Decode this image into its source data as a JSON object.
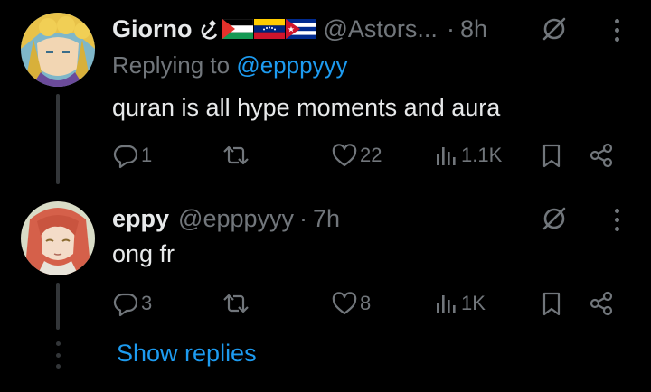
{
  "posts": [
    {
      "name": "Giorno",
      "flags": [
        "hammer-sickle",
        "palestine",
        "venezuela",
        "cuba"
      ],
      "handle": "@Astors...",
      "separator": "·",
      "time": "8h",
      "replying_prefix": "Replying to",
      "replying_to": "@epppyyy",
      "text": "quran is all hype moments and aura",
      "replies": "1",
      "reposts": "",
      "likes": "22",
      "views": "1.1K"
    },
    {
      "name": "eppy",
      "handle": "@epppyyy",
      "separator": "·",
      "time": "7h",
      "text": "ong fr",
      "replies": "3",
      "reposts": "",
      "likes": "8",
      "views": "1K"
    }
  ],
  "show_replies": "Show replies",
  "colors": {
    "background": "#000000",
    "primary_text": "#e7e9ea",
    "secondary_text": "#71767b",
    "accent": "#1d9bf0",
    "thread_line": "#333639"
  }
}
